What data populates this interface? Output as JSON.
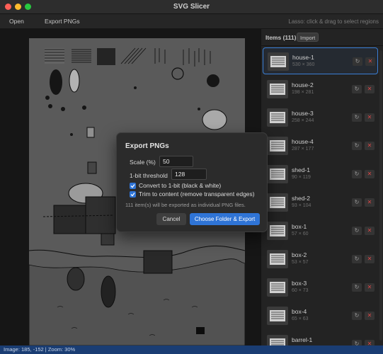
{
  "window": {
    "title": "SVG Slicer"
  },
  "toolbar": {
    "open_label": "Open",
    "export_label": "Export PNGs",
    "hint": "Lasso: click & drag to select regions"
  },
  "sidebar": {
    "title": "Items (111)",
    "import_label": "Import",
    "items": [
      {
        "name": "house-1",
        "dims": "530 × 360",
        "selected": true
      },
      {
        "name": "house-2",
        "dims": "198 × 281"
      },
      {
        "name": "house-3",
        "dims": "258 × 244"
      },
      {
        "name": "house-4",
        "dims": "287 × 177"
      },
      {
        "name": "shed-1",
        "dims": "90 × 119"
      },
      {
        "name": "shed-2",
        "dims": "93 × 104"
      },
      {
        "name": "box-1",
        "dims": "57 × 60"
      },
      {
        "name": "box-2",
        "dims": "53 × 57"
      },
      {
        "name": "box-3",
        "dims": "60 × 73"
      },
      {
        "name": "box-4",
        "dims": "65 × 63"
      },
      {
        "name": "barrel-1",
        "dims": ""
      }
    ],
    "refresh_icon": "↻",
    "delete_icon": "✕"
  },
  "dialog": {
    "title": "Export PNGs",
    "scale_label": "Scale (%)",
    "scale_value": "50",
    "threshold_label": "1-bit threshold",
    "threshold_value": "128",
    "convert_label": "Convert to 1-bit (black & white)",
    "trim_label": "Trim to content (remove transparent edges)",
    "info": "111 item(s) will be exported as individual PNG files.",
    "cancel_label": "Cancel",
    "export_label": "Choose Folder & Export"
  },
  "status": {
    "text": "Image: 185, -152 | Zoom: 30%"
  },
  "colors": {
    "accent": "#2f74d6",
    "status_bar": "#1a3d73",
    "close": "#ff5f57",
    "minimize": "#febc2e",
    "zoom": "#28c840"
  }
}
